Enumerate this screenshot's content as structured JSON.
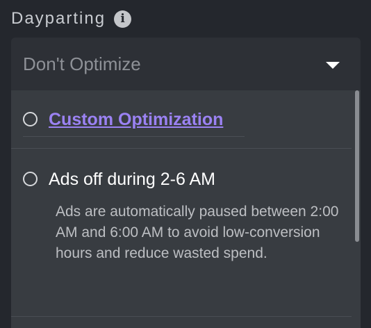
{
  "section": {
    "label": "Dayparting",
    "info_icon": "info-icon"
  },
  "dropdown": {
    "selected_value": "Don't Optimize",
    "caret_icon": "caret-down-icon"
  },
  "options": [
    {
      "label": "Custom Optimization",
      "is_link": true,
      "link_color": "#9b82f3"
    },
    {
      "label": "Ads off during 2-6 AM",
      "description": "Ads are automatically paused between 2:00 AM and 6:00 AM to avoid low-conversion hours and reduce wasted spend."
    }
  ],
  "colors": {
    "background": "#24272d",
    "dropdown_bg": "#2d3036",
    "menu_bg": "#383c41",
    "accent_link": "#9b82f3"
  }
}
